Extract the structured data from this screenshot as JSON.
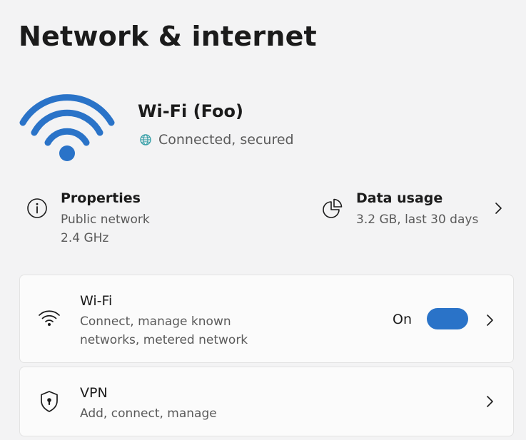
{
  "page": {
    "title": "Network & internet"
  },
  "hero": {
    "network_name": "Wi-Fi (Foo)",
    "status": "Connected, secured",
    "icon": "wifi-large-icon",
    "status_icon": "globe-icon",
    "accent_color": "#2a73c8"
  },
  "properties": {
    "title": "Properties",
    "line1": "Public network",
    "line2": "2.4 GHz",
    "icon": "info-icon"
  },
  "data_usage": {
    "title": "Data usage",
    "line1": "3.2 GB, last 30 days",
    "icon": "pie-chart-icon"
  },
  "cards": {
    "wifi": {
      "title": "Wi-Fi",
      "subtitle": "Connect, manage known networks, metered network",
      "toggle_label": "On",
      "toggle_on": true,
      "icon": "wifi-icon"
    },
    "vpn": {
      "title": "VPN",
      "subtitle": "Add, connect, manage",
      "icon": "shield-icon"
    }
  }
}
